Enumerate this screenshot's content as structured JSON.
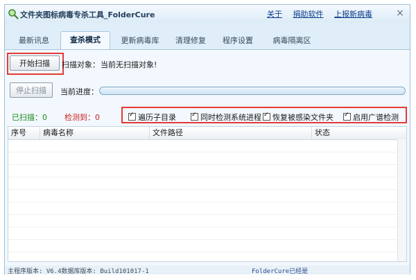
{
  "window": {
    "title": "文件夹图标病毒专杀工具_FolderCure",
    "links": [
      "关于",
      "捐助软件",
      "上报新病毒"
    ],
    "close_glyph": "×"
  },
  "tabs": [
    {
      "label": "最新讯息",
      "active": false
    },
    {
      "label": "查杀模式",
      "active": true
    },
    {
      "label": "更新病毒库",
      "active": false
    },
    {
      "label": "清理修复",
      "active": false
    },
    {
      "label": "程序设置",
      "active": false
    },
    {
      "label": "病毒隔离区",
      "active": false
    }
  ],
  "scan": {
    "start_button": "开始扫描",
    "stop_button": "停止扫描",
    "target_label": "扫描对象：",
    "target_value": "当前无扫描对象!",
    "progress_label": "当前进度：",
    "progress": 0
  },
  "stats": {
    "scanned_label": "已扫描：",
    "scanned_value": "0",
    "detected_label": "检测到：",
    "detected_value": "0"
  },
  "options": [
    {
      "label": "遍历子目录",
      "checked": true
    },
    {
      "label": "同时检测系统进程",
      "checked": true
    },
    {
      "label": "恢复被感染文件夹",
      "checked": true
    },
    {
      "label": "启用广谱检测",
      "checked": true
    }
  ],
  "table": {
    "columns": [
      "序号",
      "病毒名称",
      "文件路径",
      "状态"
    ]
  },
  "statusbar": {
    "text": "主程序版本: V6.4数据库版本: Build101017-1",
    "right_text": "FolderCure已经是"
  },
  "colors": {
    "accent": "#0b3c8c",
    "highlight": "#e53935",
    "scanned": "#1a8a1a",
    "detected": "#cc2222"
  },
  "icons": {
    "app": "magnifier-icon",
    "close": "close-icon",
    "check": "check-icon"
  }
}
